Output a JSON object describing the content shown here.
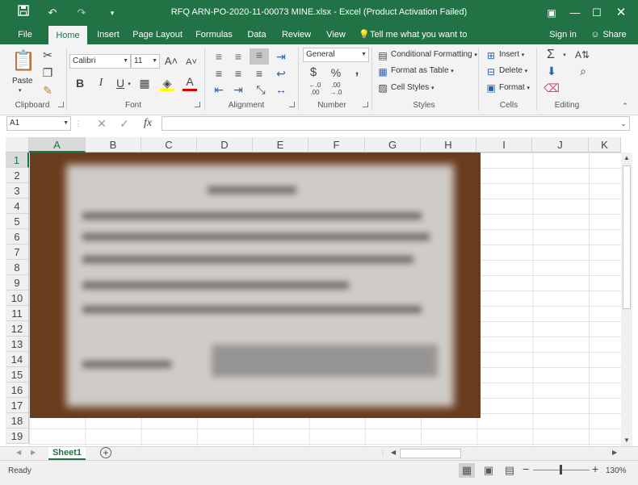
{
  "window": {
    "title": "RFQ ARN-PO-2020-11-00073 MINE.xlsx  -  Excel (Product Activation Failed)"
  },
  "qat": {
    "save_icon": "save-icon",
    "undo_icon": "undo-icon",
    "redo_icon": "redo-icon",
    "customize_icon": "chevron-down-icon"
  },
  "tabs": [
    "File",
    "Home",
    "Insert",
    "Page Layout",
    "Formulas",
    "Data",
    "Review",
    "View"
  ],
  "tell_me": "Tell me what you want to do...",
  "signin": "Sign in",
  "share": "Share",
  "ribbon": {
    "clipboard": {
      "label": "Clipboard",
      "paste": "Paste"
    },
    "font": {
      "label": "Font",
      "name": "Calibri",
      "size": "11",
      "bold": "B",
      "italic": "I",
      "underline": "U"
    },
    "alignment": {
      "label": "Alignment"
    },
    "number": {
      "label": "Number",
      "format": "General",
      "currency": "$",
      "percent": "%",
      "comma": ","
    },
    "styles": {
      "label": "Styles",
      "conditional": "Conditional Formatting",
      "format_table": "Format as Table",
      "cell_styles": "Cell Styles"
    },
    "cells": {
      "label": "Cells",
      "insert": "Insert",
      "delete": "Delete",
      "format": "Format"
    },
    "editing": {
      "label": "Editing"
    }
  },
  "namebox": "A1",
  "fx": "fx",
  "columns": [
    "A",
    "B",
    "C",
    "D",
    "E",
    "F",
    "G",
    "H",
    "I",
    "J",
    "K"
  ],
  "rows": [
    "1",
    "2",
    "3",
    "4",
    "5",
    "6",
    "7",
    "8",
    "9",
    "10",
    "11",
    "12",
    "13",
    "14",
    "15",
    "16",
    "17",
    "18",
    "19"
  ],
  "sheet": {
    "tab": "Sheet1"
  },
  "status": {
    "ready": "Ready",
    "zoom": "130%"
  }
}
